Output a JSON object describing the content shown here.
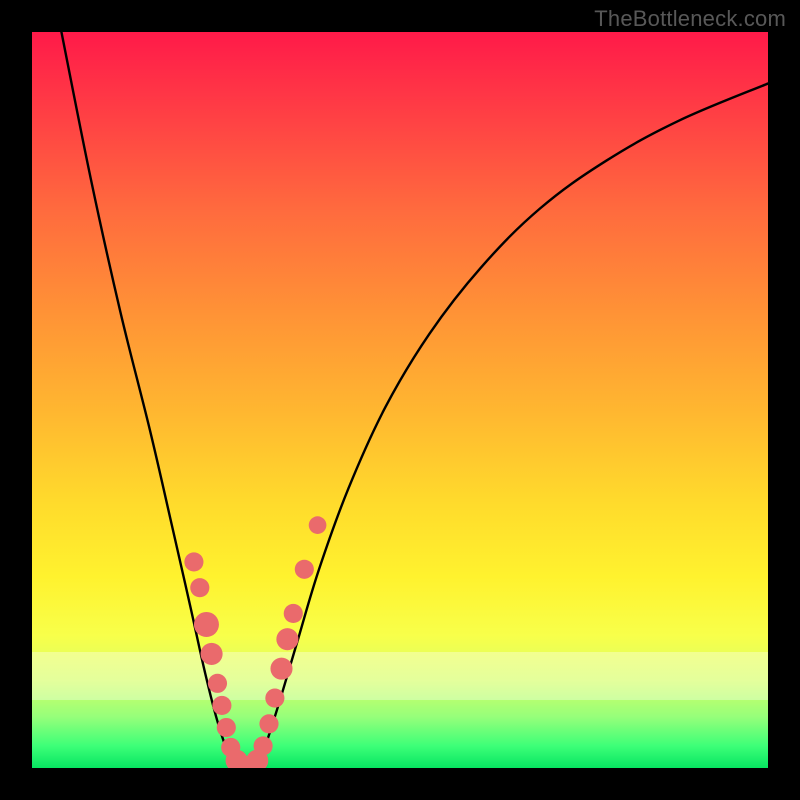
{
  "watermark": "TheBottleneck.com",
  "chart_data": {
    "type": "line",
    "title": "",
    "xlabel": "",
    "ylabel": "",
    "xlim": [
      0,
      100
    ],
    "ylim": [
      0,
      100
    ],
    "grid": false,
    "series": [
      {
        "name": "bottleneck-curve",
        "description": "V-shaped curve; left arm steep, right arm gentler concave",
        "points": [
          {
            "x": 4.0,
            "y": 100.0
          },
          {
            "x": 8.0,
            "y": 80.0
          },
          {
            "x": 12.0,
            "y": 62.0
          },
          {
            "x": 16.0,
            "y": 46.0
          },
          {
            "x": 19.0,
            "y": 33.0
          },
          {
            "x": 21.5,
            "y": 22.0
          },
          {
            "x": 23.5,
            "y": 13.0
          },
          {
            "x": 25.3,
            "y": 6.0
          },
          {
            "x": 27.0,
            "y": 1.5
          },
          {
            "x": 29.0,
            "y": 0.0
          },
          {
            "x": 31.0,
            "y": 1.5
          },
          {
            "x": 33.0,
            "y": 7.0
          },
          {
            "x": 36.0,
            "y": 17.0
          },
          {
            "x": 39.0,
            "y": 27.0
          },
          {
            "x": 43.0,
            "y": 38.0
          },
          {
            "x": 48.0,
            "y": 49.0
          },
          {
            "x": 54.0,
            "y": 59.0
          },
          {
            "x": 61.0,
            "y": 68.0
          },
          {
            "x": 69.0,
            "y": 76.0
          },
          {
            "x": 78.0,
            "y": 82.5
          },
          {
            "x": 88.0,
            "y": 88.0
          },
          {
            "x": 100.0,
            "y": 93.0
          }
        ]
      }
    ],
    "markers": {
      "description": "Salmon-pink data-point clusters near the trough of the curve",
      "color": "#ea6a6c",
      "points": [
        {
          "x": 22.0,
          "y": 28.0,
          "r": 1.3
        },
        {
          "x": 22.8,
          "y": 24.5,
          "r": 1.3
        },
        {
          "x": 23.7,
          "y": 19.5,
          "r": 1.7
        },
        {
          "x": 24.4,
          "y": 15.5,
          "r": 1.5
        },
        {
          "x": 25.2,
          "y": 11.5,
          "r": 1.3
        },
        {
          "x": 25.8,
          "y": 8.5,
          "r": 1.3
        },
        {
          "x": 26.4,
          "y": 5.5,
          "r": 1.3
        },
        {
          "x": 27.0,
          "y": 2.8,
          "r": 1.3
        },
        {
          "x": 27.8,
          "y": 1.0,
          "r": 1.5
        },
        {
          "x": 28.8,
          "y": 0.2,
          "r": 1.5
        },
        {
          "x": 29.8,
          "y": 0.2,
          "r": 1.5
        },
        {
          "x": 30.6,
          "y": 1.0,
          "r": 1.5
        },
        {
          "x": 31.4,
          "y": 3.0,
          "r": 1.3
        },
        {
          "x": 32.2,
          "y": 6.0,
          "r": 1.3
        },
        {
          "x": 33.0,
          "y": 9.5,
          "r": 1.3
        },
        {
          "x": 33.9,
          "y": 13.5,
          "r": 1.5
        },
        {
          "x": 34.7,
          "y": 17.5,
          "r": 1.5
        },
        {
          "x": 35.5,
          "y": 21.0,
          "r": 1.3
        },
        {
          "x": 37.0,
          "y": 27.0,
          "r": 1.3
        },
        {
          "x": 38.8,
          "y": 33.0,
          "r": 1.2
        }
      ]
    },
    "background": {
      "gradient": [
        "#ff1a49",
        "#ff6a3e",
        "#ffdb2c",
        "#f8ff4a",
        "#3dff78"
      ],
      "pale_band_y_range": [
        12,
        18
      ]
    }
  }
}
